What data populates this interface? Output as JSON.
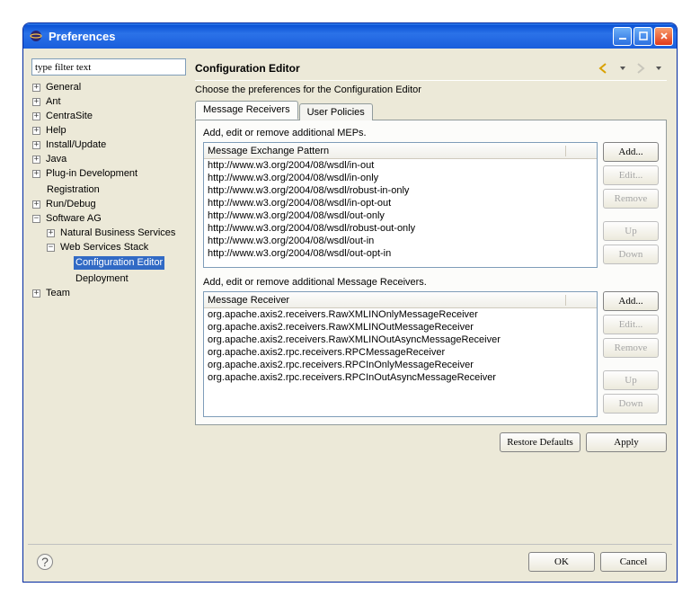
{
  "window_title": "Preferences",
  "filter_placeholder": "type filter text",
  "tree": [
    {
      "label": "General",
      "expandable": true,
      "state": "closed"
    },
    {
      "label": "Ant",
      "expandable": true,
      "state": "closed"
    },
    {
      "label": "CentraSite",
      "expandable": true,
      "state": "closed"
    },
    {
      "label": "Help",
      "expandable": true,
      "state": "closed"
    },
    {
      "label": "Install/Update",
      "expandable": true,
      "state": "closed"
    },
    {
      "label": "Java",
      "expandable": true,
      "state": "closed"
    },
    {
      "label": "Plug-in Development",
      "expandable": true,
      "state": "closed"
    },
    {
      "label": "Registration",
      "expandable": false
    },
    {
      "label": "Run/Debug",
      "expandable": true,
      "state": "closed"
    },
    {
      "label": "Software AG",
      "expandable": true,
      "state": "open",
      "children": [
        {
          "label": "Natural Business Services",
          "expandable": true,
          "state": "closed"
        },
        {
          "label": "Web Services Stack",
          "expandable": true,
          "state": "open",
          "children": [
            {
              "label": "Configuration Editor",
              "expandable": false,
              "selected": true
            },
            {
              "label": "Deployment",
              "expandable": false
            }
          ]
        }
      ]
    },
    {
      "label": "Team",
      "expandable": true,
      "state": "closed"
    }
  ],
  "right": {
    "title": "Configuration Editor",
    "desc": "Choose the preferences for the Configuration Editor",
    "tabs": [
      {
        "label": "Message Receivers",
        "active": true
      },
      {
        "label": "User Policies",
        "active": false
      }
    ],
    "sections": {
      "meps": {
        "hint": "Add, edit or remove additional MEPs.",
        "header": "Message Exchange Pattern",
        "rows": [
          "http://www.w3.org/2004/08/wsdl/in-out",
          "http://www.w3.org/2004/08/wsdl/in-only",
          "http://www.w3.org/2004/08/wsdl/robust-in-only",
          "http://www.w3.org/2004/08/wsdl/in-opt-out",
          "http://www.w3.org/2004/08/wsdl/out-only",
          "http://www.w3.org/2004/08/wsdl/robust-out-only",
          "http://www.w3.org/2004/08/wsdl/out-in",
          "http://www.w3.org/2004/08/wsdl/out-opt-in"
        ]
      },
      "receivers": {
        "hint": "Add, edit or remove additional Message Receivers.",
        "header": "Message Receiver",
        "rows": [
          "org.apache.axis2.receivers.RawXMLINOnlyMessageReceiver",
          "org.apache.axis2.receivers.RawXMLINOutMessageReceiver",
          "org.apache.axis2.receivers.RawXMLINOutAsyncMessageReceiver",
          "org.apache.axis2.rpc.receivers.RPCMessageReceiver",
          "org.apache.axis2.rpc.receivers.RPCInOnlyMessageReceiver",
          "org.apache.axis2.rpc.receivers.RPCInOutAsyncMessageReceiver"
        ]
      }
    },
    "btns": {
      "add": "Add...",
      "edit": "Edit...",
      "remove": "Remove",
      "up": "Up",
      "down": "Down",
      "restore": "Restore Defaults",
      "apply": "Apply"
    }
  },
  "dialog": {
    "ok": "OK",
    "cancel": "Cancel"
  }
}
